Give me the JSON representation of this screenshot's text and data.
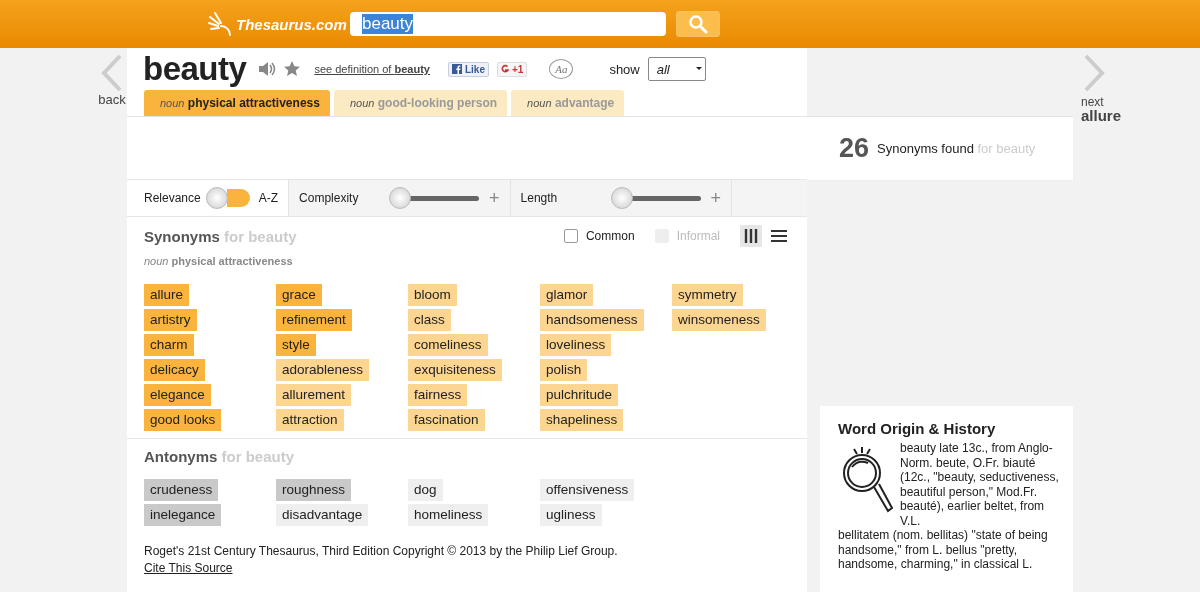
{
  "header": {
    "logo": "Thesaurus.com",
    "search": {
      "value": "beauty"
    }
  },
  "nav": {
    "back": "back",
    "next_label": "next",
    "next_word": "allure"
  },
  "entry": {
    "word": "beauty",
    "definition_link": {
      "prefix": "see definition of",
      "word": "beauty"
    },
    "like": "Like",
    "plus_one": "+1",
    "font_button": "Aa",
    "show_label": "show",
    "show_value": "all"
  },
  "tabs": [
    {
      "pos": "noun",
      "label": "physical attractiveness",
      "selected": true
    },
    {
      "pos": "noun",
      "label": "good-looking person",
      "selected": false
    },
    {
      "pos": "noun",
      "label": "advantage",
      "selected": false
    }
  ],
  "count": {
    "number": "26",
    "label": "Synonyms found",
    "for": "for beauty"
  },
  "sort": {
    "options": [
      {
        "label": "Relevance",
        "selected": true
      },
      {
        "label": "A-Z",
        "selected": false
      }
    ]
  },
  "filters": [
    {
      "label": "Complexity",
      "level": 0,
      "plus": "+"
    },
    {
      "label": "Length",
      "level": 0,
      "plus": "+"
    }
  ],
  "synonyms": {
    "title": "Synonyms",
    "for": "for beauty",
    "checkboxes": [
      {
        "label": "Common",
        "checked": false,
        "disabled": false
      },
      {
        "label": "Informal",
        "checked": false,
        "disabled": true
      }
    ],
    "views": [
      {
        "kind": "columns",
        "selected": true
      },
      {
        "kind": "list",
        "selected": false
      }
    ],
    "sense": {
      "pos": "noun",
      "label": "physical attractiveness"
    },
    "words": [
      {
        "text": "allure",
        "color": "#fab43e"
      },
      {
        "text": "artistry",
        "color": "#fab43e"
      },
      {
        "text": "charm",
        "color": "#fab43e"
      },
      {
        "text": "delicacy",
        "color": "#fab43e"
      },
      {
        "text": "elegance",
        "color": "#fab43e"
      },
      {
        "text": "good looks",
        "color": "#fab43e"
      },
      {
        "text": "grace",
        "color": "#fab43e"
      },
      {
        "text": "refinement",
        "color": "#fab43e"
      },
      {
        "text": "style",
        "color": "#fab43e"
      },
      {
        "text": "adorableness",
        "color": "#fcd591"
      },
      {
        "text": "allurement",
        "color": "#fcd591"
      },
      {
        "text": "attraction",
        "color": "#fcd591"
      },
      {
        "text": "bloom",
        "color": "#fcd591"
      },
      {
        "text": "class",
        "color": "#fcd591"
      },
      {
        "text": "comeliness",
        "color": "#fcd591"
      },
      {
        "text": "exquisiteness",
        "color": "#fcd591"
      },
      {
        "text": "fairness",
        "color": "#fcd591"
      },
      {
        "text": "fascination",
        "color": "#fcd591"
      },
      {
        "text": "glamor",
        "color": "#fcd591"
      },
      {
        "text": "handsomeness",
        "color": "#fcd591"
      },
      {
        "text": "loveliness",
        "color": "#fcd591"
      },
      {
        "text": "polish",
        "color": "#fcd591"
      },
      {
        "text": "pulchritude",
        "color": "#fcd591"
      },
      {
        "text": "shapeliness",
        "color": "#fcd591"
      },
      {
        "text": "symmetry",
        "color": "#fcd591"
      },
      {
        "text": "winsomeness",
        "color": "#fcd591"
      }
    ]
  },
  "antonyms": {
    "title": "Antonyms",
    "for": "for beauty",
    "words": [
      {
        "text": "crudeness",
        "color": "#c9c9c9"
      },
      {
        "text": "inelegance",
        "color": "#c9c9c9"
      },
      {
        "text": "roughness",
        "color": "#c9c9c9"
      },
      {
        "text": "disadvantage",
        "color": "#efefef"
      },
      {
        "text": "dog",
        "color": "#efefef"
      },
      {
        "text": "homeliness",
        "color": "#efefef"
      },
      {
        "text": "offensiveness",
        "color": "#efefef"
      },
      {
        "text": "ugliness",
        "color": "#efefef"
      }
    ]
  },
  "footer": {
    "copyright": "Roget's 21st Century Thesaurus, Third Edition Copyright © 2013 by the Philip Lief Group.",
    "cite": "Cite This Source"
  },
  "origin": {
    "title": "Word Origin & History",
    "text_beside": "beauty late 13c., from Anglo-Norm. beute, O.Fr. biauté (12c., \"beauty, seductiveness, beautiful person,\" Mod.Fr. beauté), earlier beltet, from V.L.",
    "text_below": "bellitatem (nom. bellitas) \"state of being handsome,\" from L. bellus \"pretty, handsome, charming,\" in classical L."
  }
}
